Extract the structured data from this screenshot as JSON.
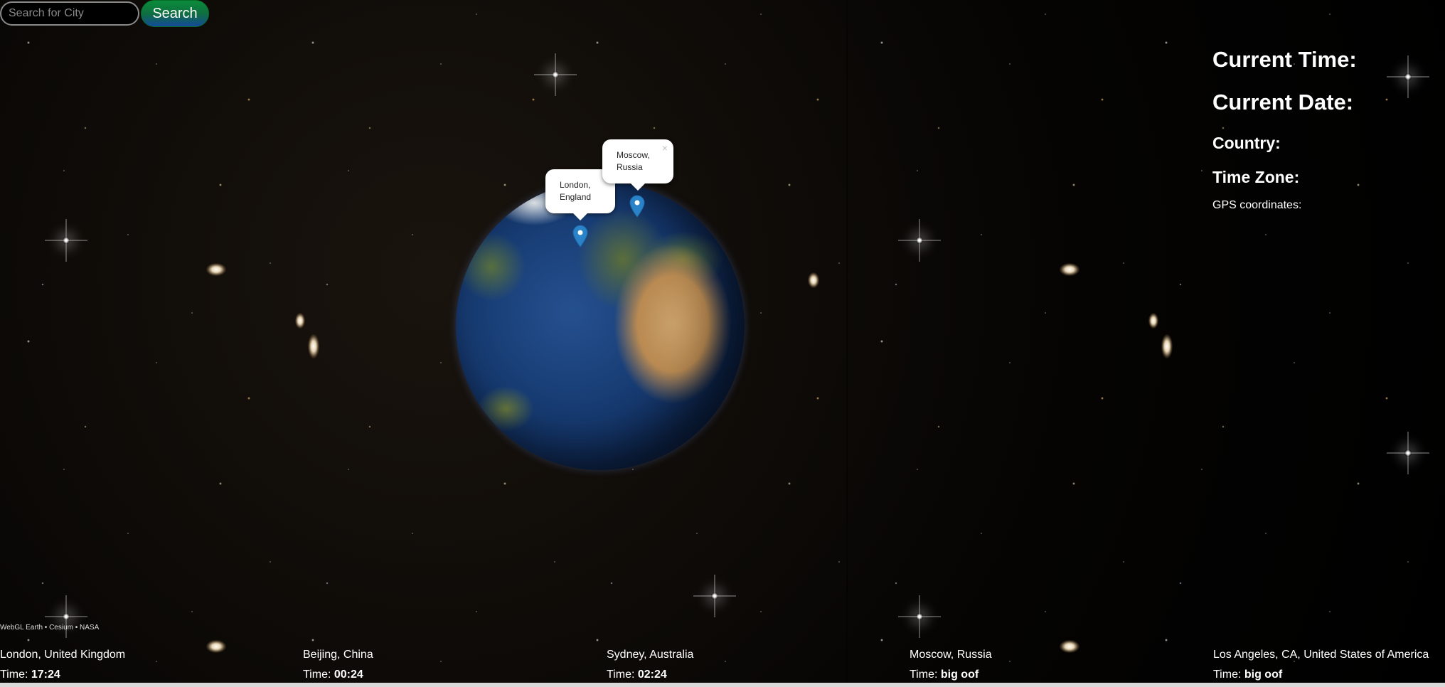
{
  "search": {
    "placeholder": "Search for City",
    "button_label": "Search"
  },
  "markers": [
    {
      "city": "London,",
      "region": "England",
      "close_label": ""
    },
    {
      "city": "Moscow,",
      "region": "Russia",
      "close_label": "×"
    }
  ],
  "info_panel": {
    "current_time_label": "Current Time:",
    "current_date_label": "Current Date:",
    "country_label": "Country:",
    "time_zone_label": "Time Zone:",
    "gps_label": "GPS coordinates:"
  },
  "attribution": "WebGL Earth • Cesium • NASA",
  "time_prefix": "Time: ",
  "cities": [
    {
      "name": "London, United Kingdom",
      "time": "17:24"
    },
    {
      "name": "Beijing, China",
      "time": "00:24"
    },
    {
      "name": "Sydney, Australia",
      "time": "02:24"
    },
    {
      "name": "Moscow, Russia",
      "time": "big oof"
    },
    {
      "name": "Los Angeles, CA, United States of America",
      "time": "big oof"
    }
  ],
  "colors": {
    "search_button_top": "#0a8c3a",
    "search_button_bottom": "#134a9a",
    "marker_blue": "#2a83c9",
    "background": "#000000"
  }
}
